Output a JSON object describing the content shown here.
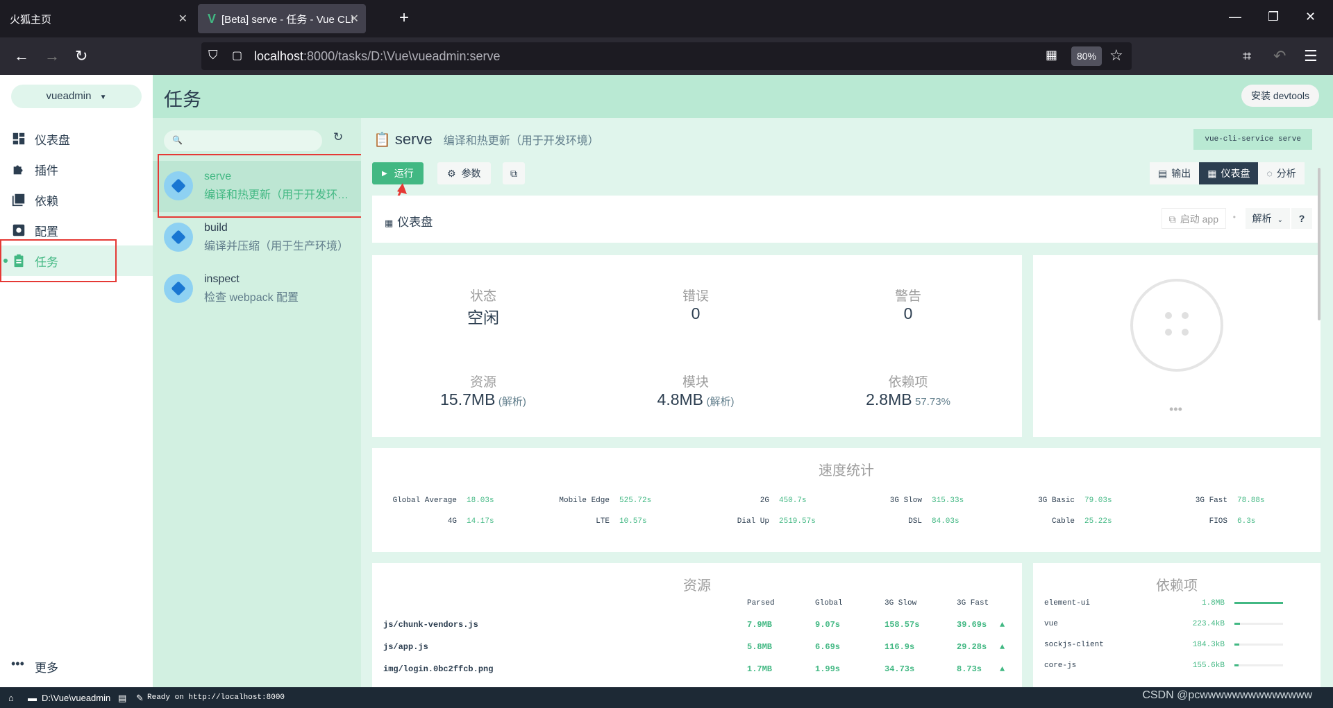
{
  "browser": {
    "tabs": [
      {
        "title": "火狐主页"
      },
      {
        "title": "[Beta] serve - 任务 - Vue CLI"
      }
    ],
    "url": {
      "host": "localhost",
      "path": ":8000/tasks/D:\\Vue\\vueadmin:serve"
    },
    "zoom": "80%"
  },
  "sidebar": {
    "project": "vueadmin",
    "items": [
      {
        "label": "仪表盘"
      },
      {
        "label": "插件"
      },
      {
        "label": "依赖"
      },
      {
        "label": "配置"
      },
      {
        "label": "任务"
      }
    ],
    "more": "更多"
  },
  "header": {
    "title": "任务",
    "devtools": "安装 devtools"
  },
  "tasks": [
    {
      "name": "serve",
      "desc": "编译和热更新（用于开发环境）"
    },
    {
      "name": "build",
      "desc": "编译并压缩（用于生产环境）"
    },
    {
      "name": "inspect",
      "desc": "检查 webpack 配置"
    }
  ],
  "detail": {
    "name": "serve",
    "desc": "编译和热更新（用于开发环境）",
    "command": "vue-cli-service serve",
    "run": "运行",
    "params": "参数",
    "views": {
      "output": "输出",
      "dashboard": "仪表盘",
      "analyze": "分析"
    },
    "panel": {
      "title": "仪表盘",
      "launch": "启动 app",
      "analyze": "解析"
    },
    "stats": {
      "status_label": "状态",
      "status": "空闲",
      "errors_label": "错误",
      "errors": "0",
      "warnings_label": "警告",
      "warnings": "0",
      "assets_label": "资源",
      "assets": "15.7MB",
      "assets_sub": "(解析)",
      "modules_label": "模块",
      "modules": "4.8MB",
      "modules_sub": "(解析)",
      "deps_label": "依赖项",
      "deps": "2.8MB",
      "deps_sub": "57.73%"
    },
    "speed": {
      "title": "速度统计",
      "row1": [
        {
          "k": "Global Average",
          "v": "18.03s"
        },
        {
          "k": "Mobile Edge",
          "v": "525.72s"
        },
        {
          "k": "2G",
          "v": "450.7s"
        },
        {
          "k": "3G Slow",
          "v": "315.33s"
        },
        {
          "k": "3G Basic",
          "v": "79.03s"
        },
        {
          "k": "3G Fast",
          "v": "78.88s"
        }
      ],
      "row2": [
        {
          "k": "4G",
          "v": "14.17s"
        },
        {
          "k": "LTE",
          "v": "10.57s"
        },
        {
          "k": "Dial Up",
          "v": "2519.57s"
        },
        {
          "k": "DSL",
          "v": "84.03s"
        },
        {
          "k": "Cable",
          "v": "25.22s"
        },
        {
          "k": "FIOS",
          "v": "6.3s"
        }
      ]
    },
    "assets": {
      "title": "资源",
      "cols": [
        "Parsed",
        "Global",
        "3G Slow",
        "3G Fast"
      ],
      "rows": [
        {
          "name": "js/chunk-vendors.js",
          "parsed": "7.9MB",
          "global": "9.07s",
          "slow": "158.57s",
          "fast": "39.69s"
        },
        {
          "name": "js/app.js",
          "parsed": "5.8MB",
          "global": "6.69s",
          "slow": "116.9s",
          "fast": "29.28s"
        },
        {
          "name": "img/login.0bc2ffcb.png",
          "parsed": "1.7MB",
          "global": "1.99s",
          "slow": "34.73s",
          "fast": "8.73s"
        }
      ]
    },
    "dependencies": {
      "title": "依赖项",
      "rows": [
        {
          "name": "element-ui",
          "size": "1.8MB",
          "ratio": 1.0
        },
        {
          "name": "vue",
          "size": "223.4kB",
          "ratio": 0.12
        },
        {
          "name": "sockjs-client",
          "size": "184.3kB",
          "ratio": 0.1
        },
        {
          "name": "core-js",
          "size": "155.6kB",
          "ratio": 0.08
        }
      ]
    }
  },
  "statusbar": {
    "path": "D:\\Vue\\vueadmin",
    "message": "Ready on http://localhost:8000"
  },
  "watermark": "CSDN @pcwwwwwwwwwwwwww",
  "colors": {
    "accent": "#42b883",
    "dark": "#2c3e50",
    "highlight": "#e53935"
  }
}
